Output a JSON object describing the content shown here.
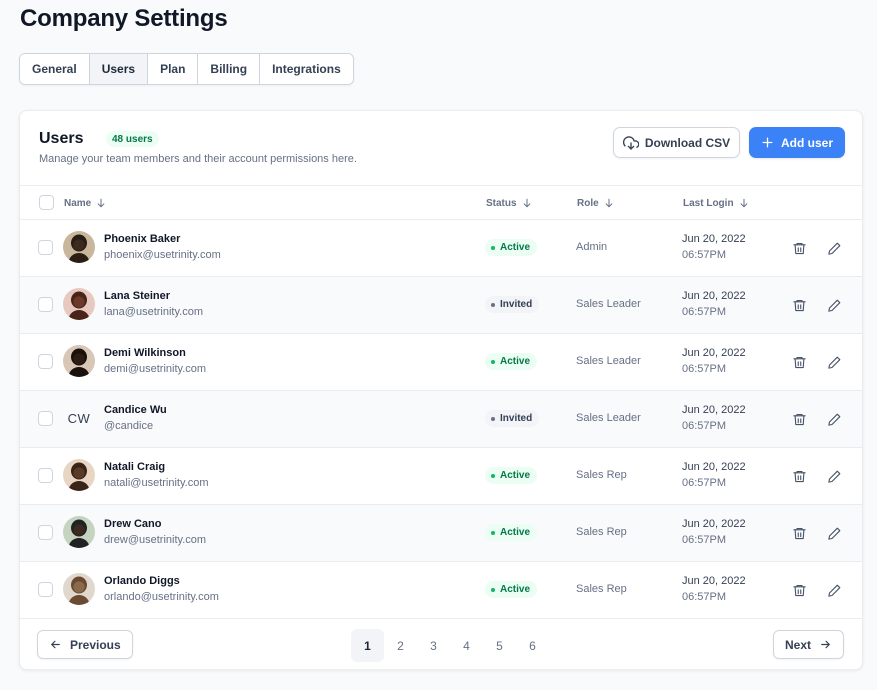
{
  "page": {
    "title": "Company Settings"
  },
  "tabs": [
    {
      "label": "General",
      "active": false
    },
    {
      "label": "Users",
      "active": true
    },
    {
      "label": "Plan",
      "active": false
    },
    {
      "label": "Billing",
      "active": false
    },
    {
      "label": "Integrations",
      "active": false
    }
  ],
  "card": {
    "title": "Users",
    "badge": "48 users",
    "subtitle": "Manage your team members and their account permissions here.",
    "download_label": "Download CSV",
    "add_label": "Add user"
  },
  "table": {
    "columns": {
      "name": "Name",
      "status": "Status",
      "role": "Role",
      "last_login": "Last Login"
    },
    "rows": [
      {
        "name": "Phoenix Baker",
        "email": "phoenix@usetrinity.com",
        "status": "Active",
        "role": "Admin",
        "date": "Jun 20, 2022",
        "time": "06:57PM",
        "avatar": "avatar-photo"
      },
      {
        "name": "Lana Steiner",
        "email": "lana@usetrinity.com",
        "status": "Invited",
        "role": "Sales Leader",
        "date": "Jun 20, 2022",
        "time": "06:57PM",
        "avatar": "avatar-photo"
      },
      {
        "name": "Demi Wilkinson",
        "email": "demi@usetrinity.com",
        "status": "Active",
        "role": "Sales Leader",
        "date": "Jun 20, 2022",
        "time": "06:57PM",
        "avatar": "avatar-photo"
      },
      {
        "name": "Candice Wu",
        "email": "@candice",
        "status": "Invited",
        "role": "Sales Leader",
        "date": "Jun 20, 2022",
        "time": "06:57PM",
        "initials": "CW"
      },
      {
        "name": "Natali Craig",
        "email": "natali@usetrinity.com",
        "status": "Active",
        "role": "Sales Rep",
        "date": "Jun 20, 2022",
        "time": "06:57PM",
        "avatar": "avatar-photo"
      },
      {
        "name": "Drew Cano",
        "email": "drew@usetrinity.com",
        "status": "Active",
        "role": "Sales Rep",
        "date": "Jun 20, 2022",
        "time": "06:57PM",
        "avatar": "avatar-photo"
      },
      {
        "name": "Orlando Diggs",
        "email": "orlando@usetrinity.com",
        "status": "Active",
        "role": "Sales Rep",
        "date": "Jun 20, 2022",
        "time": "06:57PM",
        "avatar": "avatar-photo"
      }
    ]
  },
  "pagination": {
    "previous_label": "Previous",
    "next_label": "Next",
    "pages": [
      "1",
      "2",
      "3",
      "4",
      "5",
      "6"
    ],
    "current": "1"
  },
  "icons": {
    "sort": "arrow-down-icon",
    "delete": "trash-icon",
    "edit": "pencil-icon",
    "download": "cloud-download-icon",
    "add": "plus-icon",
    "previous": "arrow-left-icon",
    "next": "arrow-right-icon"
  },
  "colors": {
    "primary": "#3b82f6",
    "active_badge_bg": "#ecfdf3",
    "active_badge_text": "#027a48",
    "invited_badge_bg": "#f2f4f7"
  }
}
